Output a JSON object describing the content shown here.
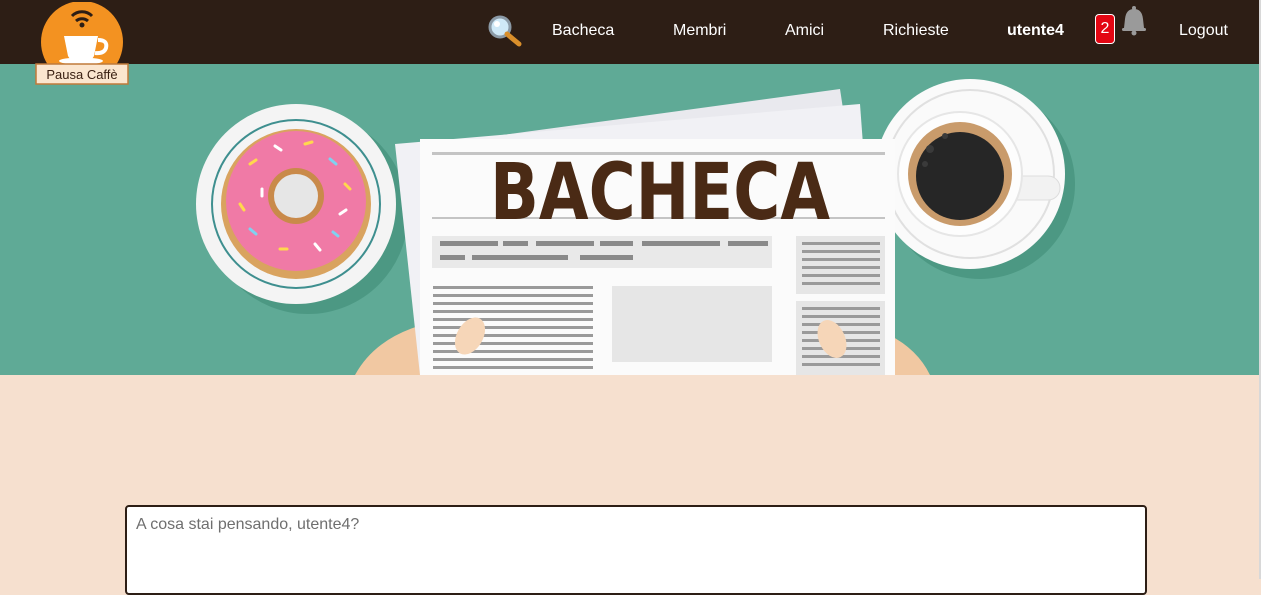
{
  "brand": {
    "logo_text": "Pausa Caffè"
  },
  "nav": {
    "items": [
      {
        "label": "Bacheca"
      },
      {
        "label": "Membri"
      },
      {
        "label": "Amici"
      },
      {
        "label": "Richieste"
      }
    ],
    "username": "utente4",
    "notification_count": "2",
    "logout_label": "Logout",
    "icons": {
      "search": "magnifier-icon",
      "notifications": "bell-icon"
    }
  },
  "hero": {
    "headline": "BACHECA"
  },
  "composer": {
    "placeholder": "A cosa stai pensando, utente4?"
  },
  "colors": {
    "topbar": "#2d1e15",
    "hero_bg": "#5faa96",
    "page_bg": "#f6e0cf",
    "badge": "#e30613",
    "logo_orange": "#f39221",
    "headline": "#4a2a15"
  }
}
